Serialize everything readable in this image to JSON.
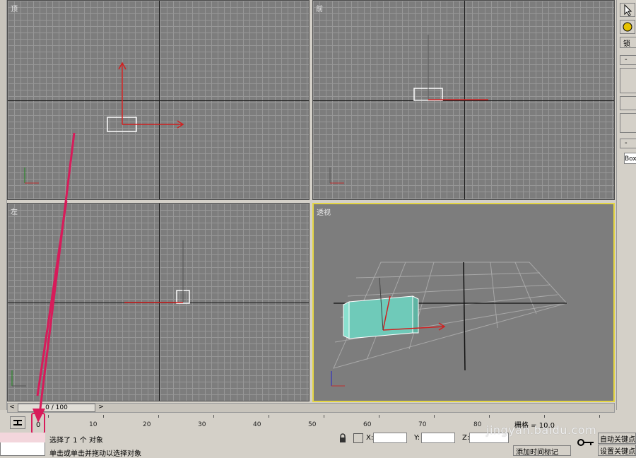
{
  "viewports": {
    "top": {
      "label": "顶"
    },
    "front": {
      "label": "前"
    },
    "left": {
      "label": "左"
    },
    "perspective": {
      "label": "透视"
    }
  },
  "timeline": {
    "slider_text": "0 / 100",
    "current_frame": "0",
    "ticks": [
      "10",
      "20",
      "30",
      "40",
      "50",
      "60",
      "70",
      "80"
    ]
  },
  "status": {
    "selection": "选择了 1 个 对象",
    "prompt": "单击或单击并拖动以选择对象",
    "x_label": "X:",
    "y_label": "Y:",
    "z_label": "Z:",
    "grid_label": "栅格 = 10.0",
    "add_time_tag": "添加时间标记",
    "auto_key": "自动关键点",
    "set_key": "设置关键点"
  },
  "panel": {
    "field_text": "Box",
    "tab_label": "锁",
    "minus": "-"
  },
  "watermark": "jingyan.baidu.com",
  "colors": {
    "active_border": "#e4d543",
    "annotation": "#d81b5a",
    "box": "#7fd7c6"
  }
}
